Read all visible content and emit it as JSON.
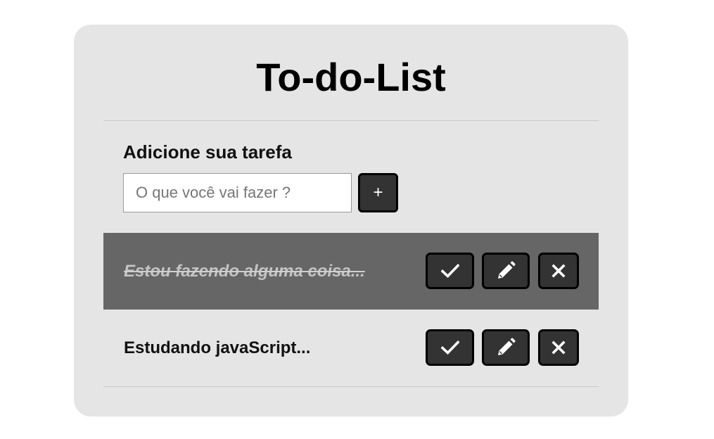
{
  "app": {
    "title": "To-do-List"
  },
  "form": {
    "label": "Adicione sua tarefa",
    "input_value": "",
    "input_placeholder": "O que você vai fazer ?",
    "add_label": "+"
  },
  "todos": [
    {
      "text": "Estou fazendo alguma coisa...",
      "done": true,
      "actions": [
        "check-icon",
        "pencil-icon",
        "close-icon"
      ]
    },
    {
      "text": "Estudando javaScript...",
      "done": false,
      "actions": [
        "check-icon",
        "pencil-icon",
        "close-icon"
      ]
    }
  ],
  "colors": {
    "background": "#ffffff",
    "card": "#e5e5e5",
    "done_row": "#666666",
    "button": "#333333",
    "button_border": "#000000",
    "icon": "#ffffff"
  }
}
